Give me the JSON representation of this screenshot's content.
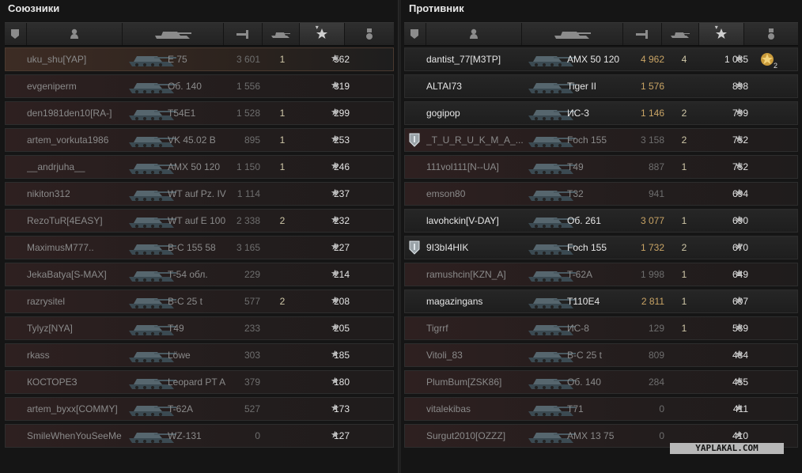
{
  "allies": {
    "title": "Союзники",
    "rows": [
      {
        "name": "uku_shu[YAP]",
        "vehicle": "E 75",
        "damage": "3 601",
        "kills": "1",
        "xp": "562",
        "self": true,
        "alive": false
      },
      {
        "name": "evgeniperm",
        "vehicle": "Об. 140",
        "damage": "1 556",
        "kills": "",
        "xp": "319",
        "alive": false
      },
      {
        "name": "den1981den10[RA-]",
        "vehicle": "T54E1",
        "damage": "1 528",
        "kills": "1",
        "xp": "299",
        "alive": false
      },
      {
        "name": "artem_vorkuta1986",
        "vehicle": "VK 45.02 B",
        "damage": "895",
        "kills": "1",
        "xp": "253",
        "alive": false
      },
      {
        "name": "__andrjuha__",
        "vehicle": "AMX 50 120",
        "damage": "1 150",
        "kills": "1",
        "xp": "246",
        "alive": false
      },
      {
        "name": "nikiton312",
        "vehicle": "WT auf Pz. IV",
        "damage": "1 114",
        "kills": "",
        "xp": "237",
        "alive": false
      },
      {
        "name": "RezoTuR[4EASY]",
        "vehicle": "WT auf E 100",
        "damage": "2 338",
        "kills": "2",
        "xp": "232",
        "alive": false
      },
      {
        "name": "MaximusM777..",
        "vehicle": "B-C 155 58",
        "damage": "3 165",
        "kills": "",
        "xp": "227",
        "alive": false
      },
      {
        "name": "JekaBatya[S-MAX]",
        "vehicle": "T-54 обл.",
        "damage": "229",
        "kills": "",
        "xp": "214",
        "alive": false
      },
      {
        "name": "razrysitel",
        "vehicle": "B-C 25 t",
        "damage": "577",
        "kills": "2",
        "xp": "208",
        "alive": false
      },
      {
        "name": "Tylyz[NYA]",
        "vehicle": "T49",
        "damage": "233",
        "kills": "",
        "xp": "205",
        "alive": false
      },
      {
        "name": "rkass",
        "vehicle": "Löwe",
        "damage": "303",
        "kills": "",
        "xp": "185",
        "alive": false
      },
      {
        "name": "КОСТОРЕЗ",
        "vehicle": "Leopard PT A",
        "damage": "379",
        "kills": "",
        "xp": "180",
        "alive": false
      },
      {
        "name": "artem_byxx[COMMY]",
        "vehicle": "T-62A",
        "damage": "527",
        "kills": "",
        "xp": "173",
        "alive": false
      },
      {
        "name": "SmileWhenYouSeeMe",
        "vehicle": "WZ-131",
        "damage": "0",
        "kills": "",
        "xp": "127",
        "alive": false
      }
    ]
  },
  "enemies": {
    "title": "Противник",
    "rows": [
      {
        "name": "dantist_77[M3TP]",
        "vehicle": "AMX 50 120",
        "damage": "4 962",
        "kills": "4",
        "xp": "1 085",
        "alive": true,
        "medal": true,
        "medal_count": "2"
      },
      {
        "name": "ALTAI73",
        "vehicle": "Tiger II",
        "damage": "1 576",
        "kills": "",
        "xp": "898",
        "alive": true
      },
      {
        "name": "gogipop",
        "vehicle": "ИС-3",
        "damage": "1 146",
        "kills": "2",
        "xp": "799",
        "alive": true
      },
      {
        "name": "_T_U_R_U_K_M_A_...",
        "vehicle": "Foch 155",
        "damage": "3 158",
        "kills": "2",
        "xp": "752",
        "alive": false,
        "platoon": true
      },
      {
        "name": "111vol111[N--UA]",
        "vehicle": "T49",
        "damage": "887",
        "kills": "1",
        "xp": "752",
        "alive": false
      },
      {
        "name": "emson80",
        "vehicle": "T32",
        "damage": "941",
        "kills": "",
        "xp": "694",
        "alive": false
      },
      {
        "name": "lavohckin[V-DAY]",
        "vehicle": "Об. 261",
        "damage": "3 077",
        "kills": "1",
        "xp": "690",
        "alive": true
      },
      {
        "name": "9I3bI4HIK",
        "vehicle": "Foch 155",
        "damage": "1 732",
        "kills": "2",
        "xp": "670",
        "alive": true,
        "platoon": true
      },
      {
        "name": "ramushcin[KZN_A]",
        "vehicle": "T-62A",
        "damage": "1 998",
        "kills": "1",
        "xp": "649",
        "alive": false
      },
      {
        "name": "magazingans",
        "vehicle": "T110E4",
        "damage": "2 811",
        "kills": "1",
        "xp": "607",
        "alive": true
      },
      {
        "name": "Tigrrf",
        "vehicle": "ИС-8",
        "damage": "129",
        "kills": "1",
        "xp": "569",
        "alive": false
      },
      {
        "name": "Vitoli_83",
        "vehicle": "B-C 25 t",
        "damage": "809",
        "kills": "",
        "xp": "484",
        "alive": false
      },
      {
        "name": "PlumBum[ZSK86]",
        "vehicle": "Об. 140",
        "damage": "284",
        "kills": "",
        "xp": "455",
        "alive": false
      },
      {
        "name": "vitalekibas",
        "vehicle": "T71",
        "damage": "0",
        "kills": "",
        "xp": "411",
        "alive": false
      },
      {
        "name": "Surgut2010[OZZZ]",
        "vehicle": "AMX 13 75",
        "damage": "0",
        "kills": "",
        "xp": "410",
        "alive": false
      }
    ]
  },
  "watermark": "YAPLAKAL.COM"
}
